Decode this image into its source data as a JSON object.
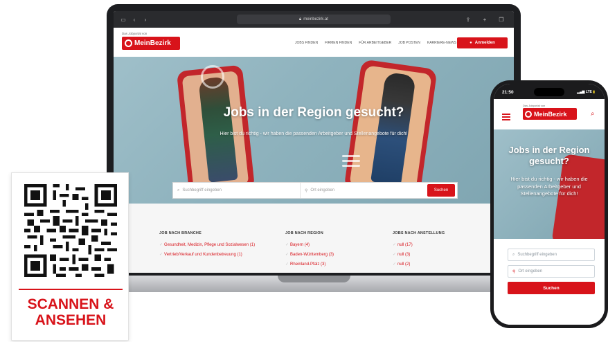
{
  "browser": {
    "url": "meinbezirk.at"
  },
  "site": {
    "tagline": "Das Jobportal von",
    "logo_text": "MeinBezirk",
    "nav": [
      "JOBS FINDEN",
      "FIRMEN FINDEN",
      "FÜR ARBEITGEBER",
      "JOB POSTEN",
      "KARRIERE-NEWS"
    ],
    "login_label": "Anmelden"
  },
  "hero": {
    "title": "Jobs in der Region gesucht?",
    "subtitle": "Hier bist du richtig - wir haben die passenden Arbeitgeber und Stellenangebote für dich!"
  },
  "search": {
    "keyword_placeholder": "Suchbegriff eingeben",
    "location_placeholder": "Ort eingeben",
    "button_label": "Suchen"
  },
  "categories": {
    "branche": {
      "title": "JOB NACH BRANCHE",
      "items": [
        "Gesundheit, Medizin, Pflege und Sozialwesen (1)",
        "Vertrieb/Verkauf und Kundenbetreuung (1)"
      ]
    },
    "region": {
      "title": "JOB NACH REGION",
      "items": [
        "Bayern (4)",
        "Baden-Württemberg (3)",
        "Rheinland-Pfalz (3)"
      ]
    },
    "anstellung": {
      "title": "JOBS NACH ANSTELLUNG",
      "items": [
        "null (17)",
        "null (3)",
        "null (2)"
      ]
    }
  },
  "qr": {
    "line1": "SCANNEN &",
    "line2": "ANSEHEN"
  },
  "phone": {
    "time": "21:50",
    "signal": "LTE",
    "tagline": "Das Jobportal von",
    "logo_text": "MeinBezirk",
    "hero_title": "Jobs in der Region gesucht?",
    "hero_subtitle": "Hier bist du richtig - wir haben die passenden Arbeitgeber und Stellenangebote für dich!",
    "keyword_placeholder": "Suchbegriff eingeben",
    "location_placeholder": "Ort eingeben",
    "button_label": "Suchen"
  },
  "colors": {
    "brand_red": "#d8131a",
    "hero_teal": "#9fbfc9"
  }
}
